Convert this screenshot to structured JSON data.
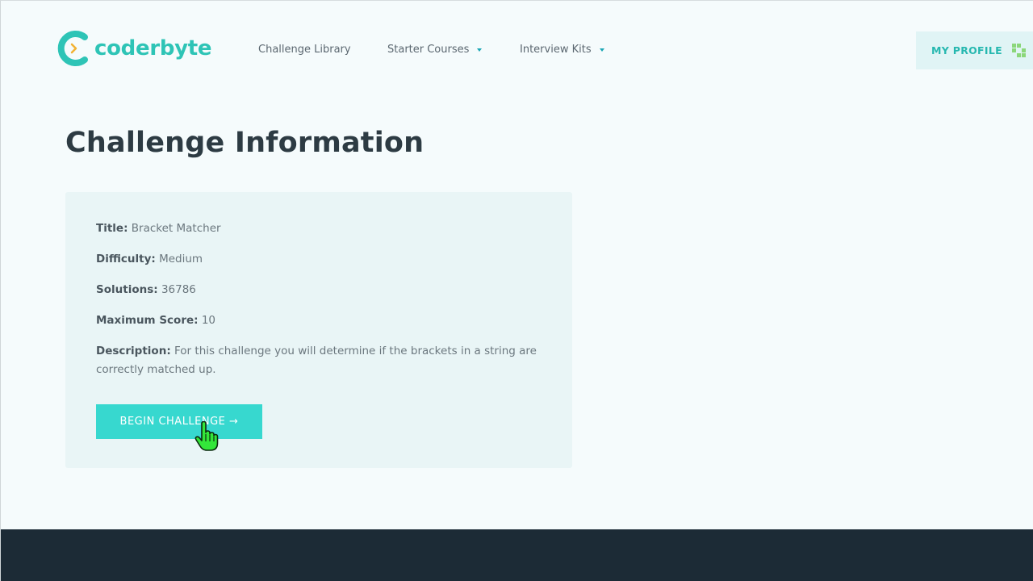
{
  "brand": {
    "name": "coderbyte",
    "accent_color": "#2ec4b6"
  },
  "nav": {
    "items": [
      {
        "label": "Challenge Library",
        "has_dropdown": false
      },
      {
        "label": "Starter Courses",
        "has_dropdown": true
      },
      {
        "label": "Interview Kits",
        "has_dropdown": true
      }
    ],
    "profile_label": "MY PROFILE",
    "profile_icon": "pixel-avatar-icon"
  },
  "page": {
    "title": "Challenge Information"
  },
  "challenge": {
    "title_label": "Title:",
    "title_value": "Bracket Matcher",
    "difficulty_label": "Difficulty:",
    "difficulty_value": "Medium",
    "solutions_label": "Solutions:",
    "solutions_value": "36786",
    "max_score_label": "Maximum Score:",
    "max_score_value": "10",
    "description_label": "Description:",
    "description_value": "For this challenge you will determine if the brackets in a string are correctly matched up.",
    "begin_label": "BEGIN CHALLENGE →",
    "button_color": "#37d8cf"
  },
  "cursor_icon": "hand-pointer-icon",
  "footer_color": "#1c2b36"
}
